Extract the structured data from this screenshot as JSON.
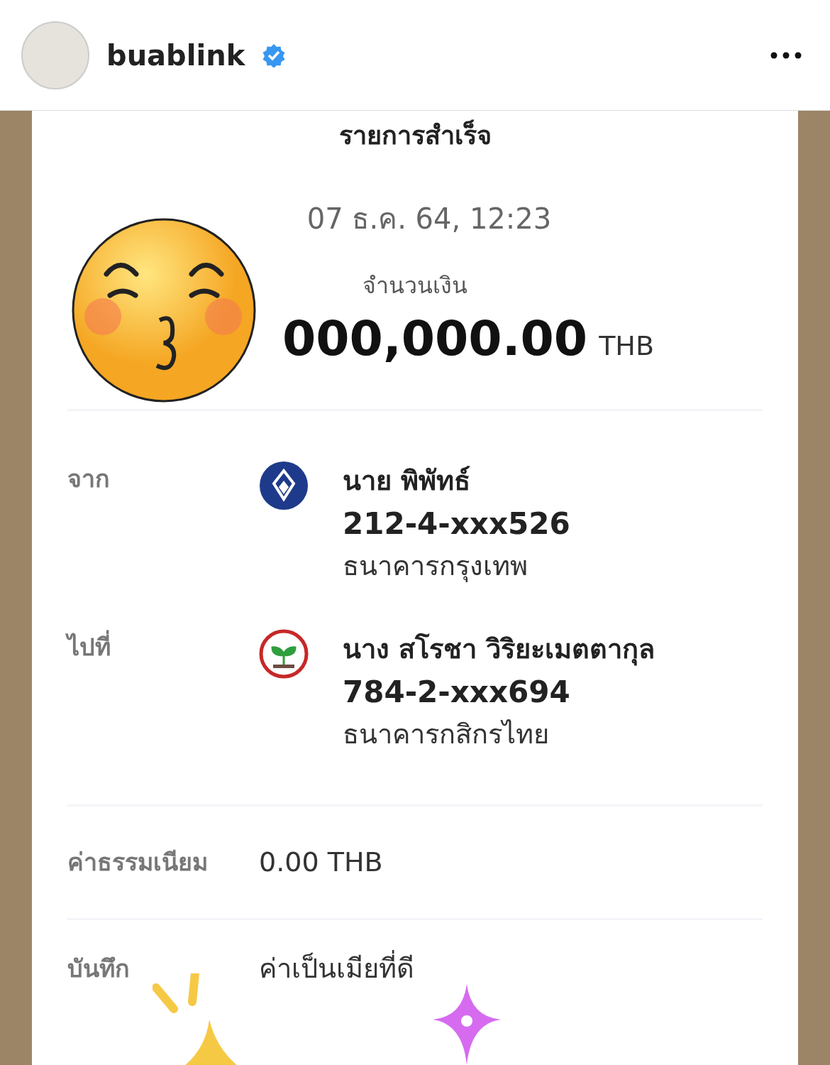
{
  "post_header": {
    "username": "buablink",
    "verified": true
  },
  "slip": {
    "title": "รายการสำเร็จ",
    "datetime": "07 ธ.ค. 64, 12:23",
    "amount_label": "จำนวนเงิน",
    "amount": "000,000.00",
    "currency": "THB",
    "parties": [
      {
        "label": "จาก",
        "name": "นาย พิพัทธ์",
        "account": "212-4-xxx526",
        "bank": "ธนาคารกรุงเทพ",
        "kind": "bbl"
      },
      {
        "label": "ไปที่",
        "name": "นาง สโรชา วิริยะเมตตากุล",
        "account": "784-2-xxx694",
        "bank": "ธนาคารกสิกรไทย",
        "kind": "kbank"
      }
    ],
    "fee_label": "ค่าธรรมเนียม",
    "fee": "0.00 THB",
    "memo_label": "บันทึก",
    "memo": "ค่าเป็นเมียที่ดี"
  }
}
